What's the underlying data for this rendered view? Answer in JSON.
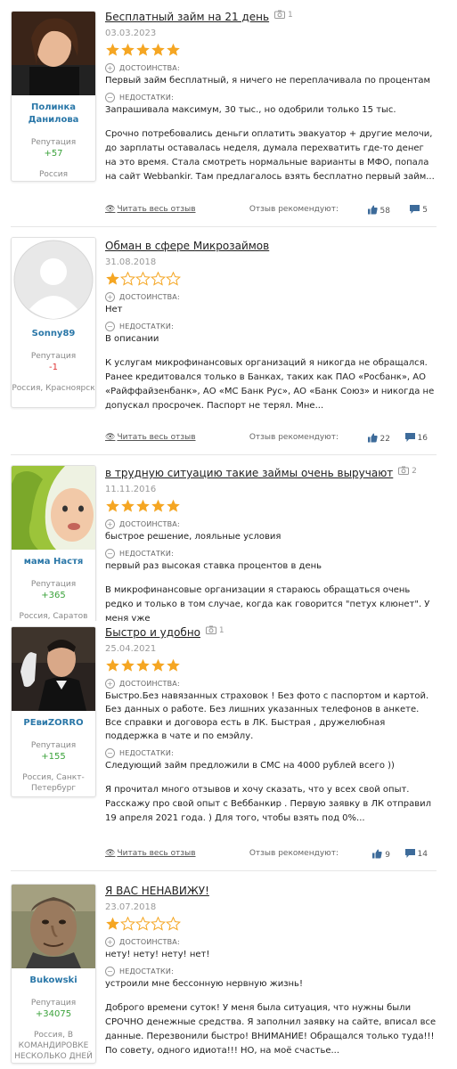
{
  "reviews": [
    {
      "user": "Полинка Данилова",
      "rep_label": "Репутация",
      "rep": "+57",
      "location": "Россия",
      "title": "Бесплатный займ на 21 день",
      "photos": "1",
      "date": "03.03.2023",
      "stars": 5,
      "pros_label": "ДОСТОИНСТВА:",
      "pros": "Первый займ бесплатный, я ничего не переплачивала по процентам",
      "cons_label": "НЕДОСТАТКИ:",
      "cons": "Запрашивала максимум, 30 тыс., но одобрили только 15 тыс.",
      "body": "Срочно потребовались деньги оплатить эвакуатор + другие мелочи, до зарплаты оставалась неделя, думала перехватить где-то денег на это время. Стала смотреть нормальные варианты в МФО, попала на сайт Webbankir. Там предлагалось взять бесплатно первый займ...",
      "read_all": "Читать весь отзыв",
      "recommend": "Отзыв рекомендуют:",
      "likes": "58",
      "comments": "5"
    },
    {
      "user": "Sonny89",
      "rep_label": "Репутация",
      "rep": "-1",
      "location": "Россия, Красноярск",
      "title": "Обман в сфере Микрозаймов",
      "photos": "",
      "date": "31.08.2018",
      "stars": 1,
      "pros_label": "ДОСТОИНСТВА:",
      "pros": "Нет",
      "cons_label": "НЕДОСТАТКИ:",
      "cons": "В описании",
      "body": "К услугам микрофинансовых организаций я никогда не обращался. Ранее кредитовался только в Банках, таких как ПАО «Росбанк», АО «Райффайзенбанк», АО «МС Банк Рус», АО «Банк Союз» и никогда не допускал просрочек. Паспорт не терял. Мне...",
      "read_all": "Читать весь отзыв",
      "recommend": "Отзыв рекомендуют:",
      "likes": "22",
      "comments": "16"
    },
    {
      "user": "мама Настя",
      "rep_label": "Репутация",
      "rep": "+365",
      "location": "Россия, Саратов",
      "title": "в трудную ситуацию такие займы очень выручают",
      "photos": "2",
      "date": "11.11.2016",
      "stars": 5,
      "pros_label": "ДОСТОИНСТВА:",
      "pros": "быстрое решение, лояльные условия",
      "cons_label": "НЕДОСТАТКИ:",
      "cons": "первый раз высокая ставка процентов в день",
      "body": "В микрофинансовые организации я стараюсь обращаться очень редко и только в том случае, когда как говорится \"петух клюнет\". У меня уже",
      "read_all": "",
      "recommend": "",
      "likes": "",
      "comments": ""
    },
    {
      "user": "PЕвиZORRO",
      "rep_label": "Репутация",
      "rep": "+155",
      "location": "Россия, Санкт-Петербург",
      "title": "Быстро и удобно",
      "photos": "1",
      "date": "25.04.2021",
      "stars": 5,
      "pros_label": "ДОСТОИНСТВА:",
      "pros": "Быстро.Без навязанных страховок ! Без фото с паспортом и картой. Без данных о работе. Без лишних указанных телефонов в анкете. Все справки и договора есть в ЛК. Быстрая , дружелюбная поддержка в чате и по емэйлу.",
      "cons_label": "НЕДОСТАТКИ:",
      "cons": "Следующий займ предложили в СМС на 4000 рублей всего ))",
      "body": "Я прочитал много отзывов и хочу сказать, что у всех свой опыт. Расскажу про свой опыт с Веббанкир . Первую заявку в ЛК отправил 19 апреля 2021 года. ) Для того, чтобы взять под 0%...",
      "read_all": "Читать весь отзыв",
      "recommend": "Отзыв рекомендуют:",
      "likes": "9",
      "comments": "14"
    },
    {
      "user": "Bukowski",
      "rep_label": "Репутация",
      "rep": "+34075",
      "location": "Россия, В КОМАНДИРОВКЕ НЕСКОЛЬКО ДНЕЙ",
      "title": "Я ВАС НЕНАВИЖУ!",
      "photos": "",
      "date": "23.07.2018",
      "stars": 1,
      "pros_label": "ДОСТОИНСТВА:",
      "pros": "нету! нету! нету! нет!",
      "cons_label": "НЕДОСТАТКИ:",
      "cons": "устроили мне бессонную нервную жизнь!",
      "body": "Доброго времени суток! У меня была ситуация, что нужны были СРОЧНО денежные средства. Я заполнил заявку на сайте, вписал все данные. Перезвонили быстро! ВНИМАНИЕ! Обращался только туда!!! По совету, одного идиота!!! НО, на моё счастье...",
      "read_all": "",
      "recommend": "",
      "likes": "",
      "comments": ""
    }
  ],
  "colors": {
    "star": "#f5a623",
    "star_empty": "#f5a623",
    "link": "#2a77a8",
    "positive": "#3aa23a",
    "negative": "#dd3333"
  }
}
